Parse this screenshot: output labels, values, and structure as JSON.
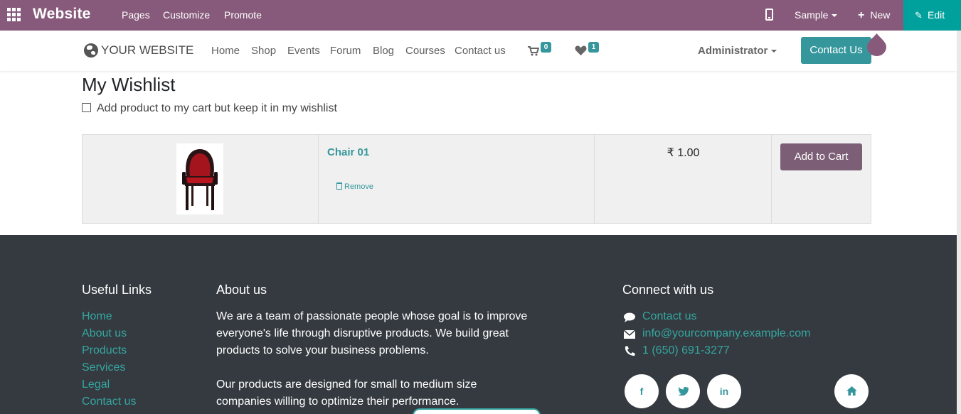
{
  "adminbar": {
    "app_title": "Website",
    "menu": [
      "Pages",
      "Customize",
      "Promote"
    ],
    "sample_label": "Sample",
    "new_label": "New",
    "edit_label": "Edit"
  },
  "header": {
    "logo_text": "YOUR WEBSITE",
    "nav": [
      "Home",
      "Shop",
      "Events",
      "Forum",
      "Blog",
      "Courses",
      "Contact us"
    ],
    "cart_count": "0",
    "wishlist_count": "1",
    "user_menu": "Administrator",
    "contact_button": "Contact Us"
  },
  "main": {
    "title": "My Wishlist",
    "keep_in_wishlist_label": "Add product to my cart but keep it in my wishlist",
    "items": [
      {
        "name": "Chair 01",
        "remove_label": "Remove",
        "price": "₹ 1.00",
        "add_to_cart_label": "Add to Cart"
      }
    ]
  },
  "footer": {
    "useful_links_title": "Useful Links",
    "useful_links": [
      "Home",
      "About us",
      "Products",
      "Services",
      "Legal",
      "Contact us"
    ],
    "about_title": "About us",
    "about_lines": [
      "We are a team of passionate people whose goal is to improve",
      "everyone's life through disruptive products. We build great",
      "products to solve your business problems.",
      "",
      "Our products are designed for small to medium size",
      "companies willing to optimize their performance."
    ],
    "connect_title": "Connect with us",
    "contact_link": "Contact us",
    "email": "info@yourcompany.example.com",
    "phone": "1 (650) 691-3277",
    "social": [
      "f",
      "t",
      "in",
      "home"
    ]
  },
  "colors": {
    "admin_bar": "#875a7b",
    "edit_button": "#00a09d",
    "accent": "#35979c",
    "add_to_cart": "#7c5f76",
    "footer_bg": "#343a40"
  }
}
